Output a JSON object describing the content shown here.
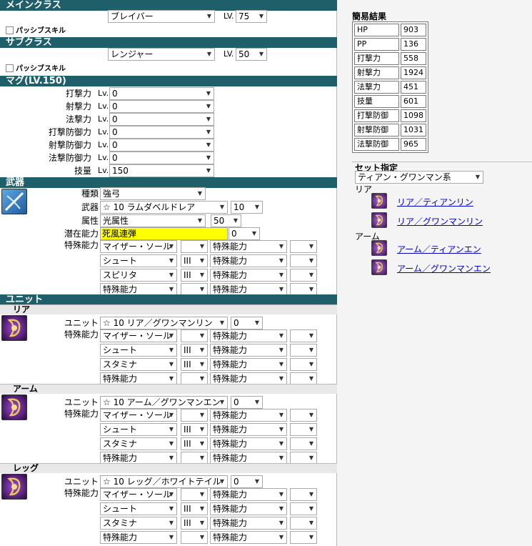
{
  "main_class": {
    "header": "メインクラス",
    "class_value": "ブレイバー",
    "lv_label": "LV.",
    "lv_value": "75",
    "passive_label": "パッシブスキル"
  },
  "sub_class": {
    "header": "サブクラス",
    "class_value": "レンジャー",
    "lv_label": "LV.",
    "lv_value": "50",
    "passive_label": "パッシブスキル"
  },
  "mag": {
    "header": "マグ(LV.150)",
    "lv_prefix": "Lv.",
    "rows": [
      {
        "label": "打撃力",
        "value": "0"
      },
      {
        "label": "射撃力",
        "value": "0"
      },
      {
        "label": "法撃力",
        "value": "0"
      },
      {
        "label": "打撃防御力",
        "value": "0"
      },
      {
        "label": "射撃防御力",
        "value": "0"
      },
      {
        "label": "法撃防御力",
        "value": "0"
      },
      {
        "label": "技量",
        "value": "150"
      }
    ]
  },
  "weapon": {
    "header": "武器",
    "icon": "rifle-weapon-icon",
    "type_label": "種類",
    "type_value": "強弓",
    "weapon_label": "武器",
    "weapon_value": "☆ 10 ラムダベルドレア",
    "grind_value": "10",
    "element_label": "属性",
    "element_value": "光属性",
    "element_pct": "50",
    "latent_label": "潜在能力",
    "latent_value": "死風連弾",
    "latent_level": "0",
    "ability_label": "特殊能力",
    "abilities": [
      {
        "a": "マイザー・ソール",
        "b": "",
        "c": "特殊能力",
        "d": ""
      },
      {
        "a": "シュート",
        "b": "III",
        "c": "特殊能力",
        "d": ""
      },
      {
        "a": "スピリタ",
        "b": "III",
        "c": "特殊能力",
        "d": ""
      },
      {
        "a": "特殊能力",
        "b": "",
        "c": "特殊能力",
        "d": ""
      }
    ]
  },
  "unit": {
    "header": "ユニット",
    "unit_label": "ユニット",
    "ability_label": "特殊能力",
    "slots": [
      {
        "name": "リア",
        "icon": "rear-unit-icon",
        "unit_value": "☆ 10 リア／グワンマンリン",
        "grind": "0",
        "abilities": [
          {
            "a": "マイザー・ソール",
            "b": "",
            "c": "特殊能力",
            "d": ""
          },
          {
            "a": "シュート",
            "b": "III",
            "c": "特殊能力",
            "d": ""
          },
          {
            "a": "スタミナ",
            "b": "III",
            "c": "特殊能力",
            "d": ""
          },
          {
            "a": "特殊能力",
            "b": "",
            "c": "特殊能力",
            "d": ""
          }
        ]
      },
      {
        "name": "アーム",
        "icon": "arm-unit-icon",
        "unit_value": "☆ 10 アーム／グワンマンエン",
        "grind": "0",
        "abilities": [
          {
            "a": "マイザー・ソール",
            "b": "",
            "c": "特殊能力",
            "d": ""
          },
          {
            "a": "シュート",
            "b": "III",
            "c": "特殊能力",
            "d": ""
          },
          {
            "a": "スタミナ",
            "b": "III",
            "c": "特殊能力",
            "d": ""
          },
          {
            "a": "特殊能力",
            "b": "",
            "c": "特殊能力",
            "d": ""
          }
        ]
      },
      {
        "name": "レッグ",
        "icon": "leg-unit-icon",
        "unit_value": "☆ 10 レッグ／ホワイトテイル",
        "grind": "0",
        "abilities": [
          {
            "a": "マイザー・ソール",
            "b": "",
            "c": "特殊能力",
            "d": ""
          },
          {
            "a": "シュート",
            "b": "III",
            "c": "特殊能力",
            "d": ""
          },
          {
            "a": "スタミナ",
            "b": "III",
            "c": "特殊能力",
            "d": ""
          },
          {
            "a": "特殊能力",
            "b": "",
            "c": "特殊能力",
            "d": ""
          }
        ]
      }
    ]
  },
  "summary": {
    "title": "簡易結果",
    "stats": [
      {
        "k": "HP",
        "v": "903"
      },
      {
        "k": "PP",
        "v": "136"
      },
      {
        "k": "打撃力",
        "v": "558"
      },
      {
        "k": "射撃力",
        "v": "1924"
      },
      {
        "k": "法撃力",
        "v": "451"
      },
      {
        "k": "技量",
        "v": "601"
      },
      {
        "k": "打撃防御",
        "v": "1098"
      },
      {
        "k": "射撃防御",
        "v": "1031"
      },
      {
        "k": "法撃防御",
        "v": "965"
      }
    ]
  },
  "set_spec": {
    "title": "セット指定",
    "select_value": "ティアン・グワンマン系",
    "groups": [
      {
        "name": "リア",
        "links": [
          "リア／ティアンリン",
          "リア／グワンマンリン"
        ]
      },
      {
        "name": "アーム",
        "links": [
          "アーム／ティアンエン",
          "アーム／グワンマンエン"
        ]
      }
    ]
  }
}
